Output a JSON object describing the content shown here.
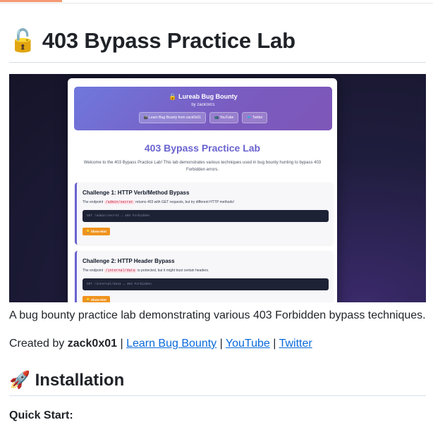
{
  "readme": {
    "title_icon": "🔓",
    "title": "403 Bypass Practice Lab",
    "description": "A bug bounty practice lab demonstrating various 403 Forbidden bypass techniques.",
    "credits": {
      "prefix": "Created by ",
      "author": "zack0x01",
      "sep": " | ",
      "links": [
        "Learn Bug Bounty",
        "YouTube",
        "Twitter"
      ]
    },
    "install_icon": "🚀",
    "install_heading": "Installation",
    "quick_start": "Quick Start:"
  },
  "screenshot": {
    "brand": "🔒 Lureab Bug Bounty",
    "byline": "by zack0x01",
    "buttons": [
      "🎬 Learn Bug Bounty from zack0x01",
      "📺 YouTube",
      "🐦 Twitter"
    ],
    "heading": "403 Bypass Practice Lab",
    "intro": "Welcome to the 403 Bypass Practice Lab! This lab demonstrates various techniques used in bug bounty hunting to bypass 403 Forbidden errors.",
    "challenges": [
      {
        "title": "Challenge 1: HTTP Verb/Method Bypass",
        "desc_pre": "The endpoint ",
        "endpoint": "/admin/secret",
        "desc_post": " returns 403 with GET requests, but try different HTTP methods!",
        "code": "GET /admin/secret → 403 Forbidden",
        "hint": "💡 Show Hint"
      },
      {
        "title": "Challenge 2: HTTP Header Bypass",
        "desc_pre": "The endpoint ",
        "endpoint": "/internal/data",
        "desc_post": " is protected, but it might trust certain headers.",
        "code": "GET /internal/data → 403 Forbidden",
        "hint": "💡 Show Hint"
      }
    ]
  },
  "colors": {
    "link": "#0969da",
    "accent": "#6a63cf",
    "hint": "#f0931e"
  }
}
